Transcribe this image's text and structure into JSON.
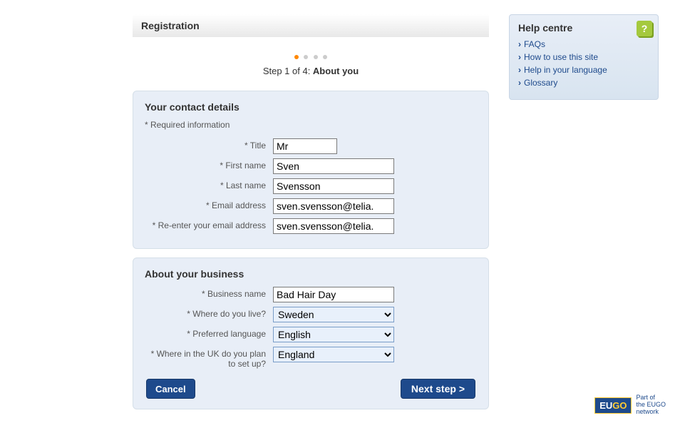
{
  "header": {
    "title": "Registration"
  },
  "step": {
    "prefix": "Step 1 of 4: ",
    "name": "About you",
    "current": 1,
    "total": 4
  },
  "section1": {
    "heading": "Your contact details",
    "required_note": "* Required information",
    "fields": {
      "title": {
        "label": "* Title",
        "value": "Mr"
      },
      "first_name": {
        "label": "* First name",
        "value": "Sven"
      },
      "last_name": {
        "label": "* Last name",
        "value": "Svensson"
      },
      "email": {
        "label": "* Email address",
        "value": "sven.svensson@telia."
      },
      "email2": {
        "label": "* Re-enter your email address",
        "value": "sven.svensson@telia."
      }
    }
  },
  "section2": {
    "heading": "About your business",
    "fields": {
      "business_name": {
        "label": "* Business name",
        "value": "Bad Hair Day"
      },
      "where_live": {
        "label": "* Where do you live?",
        "value": "Sweden"
      },
      "language": {
        "label": "* Preferred language",
        "value": "English"
      },
      "where_uk": {
        "label": "* Where in the UK do you plan to set up?",
        "value": "England"
      }
    }
  },
  "buttons": {
    "cancel": "Cancel",
    "next": "Next step >"
  },
  "help": {
    "heading": "Help centre",
    "items": [
      "FAQs",
      "How to use this site",
      "Help in your language",
      "Glossary"
    ]
  },
  "footer": {
    "eu": "EU",
    "go": "GO",
    "tagline1": "Part of",
    "tagline2": "the EUGO",
    "tagline3": "network"
  }
}
